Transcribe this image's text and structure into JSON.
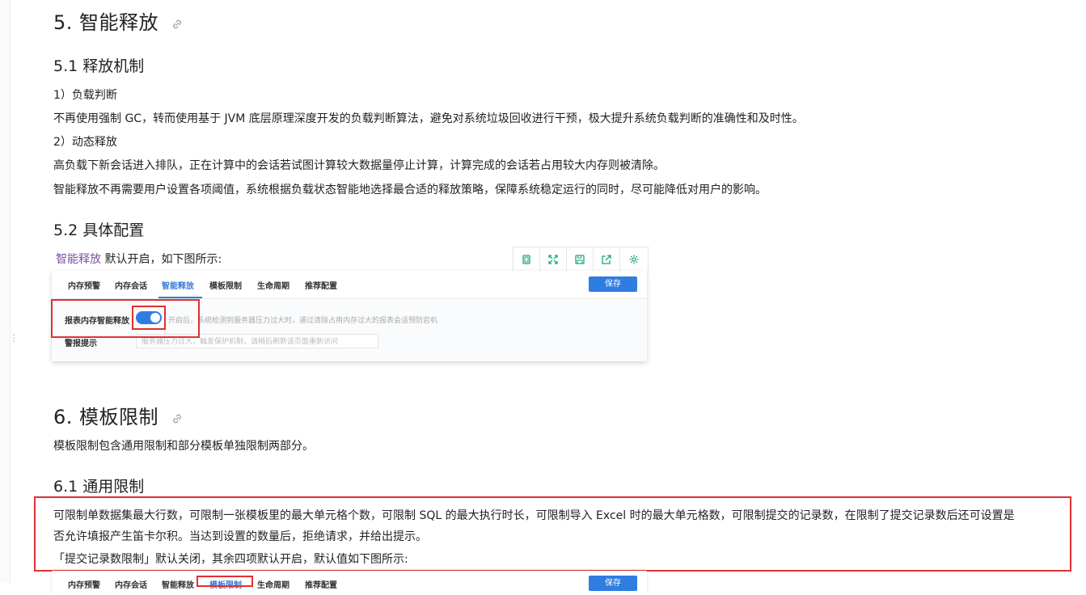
{
  "section5": {
    "title": "5. 智能释放",
    "s51": {
      "title": "5.1 释放机制",
      "item1_title": "1）负载判断",
      "item1_text": "不再使用强制 GC，转而使用基于 JVM 底层原理深度开发的负载判断算法，避免对系统垃圾回收进行干预，极大提升系统负载判断的准确性和及时性。",
      "item2_title": "2）动态释放",
      "item2_text": "高负载下新会话进入排队，正在计算中的会话若试图计算较大数据量停止计算，计算完成的会话若占用较大内存则被清除。",
      "item2_text2": "智能释放不再需要用户设置各项阈值，系统根据负载状态智能地选择最合适的释放策略，保障系统稳定运行的同时，尽可能降低对用户的影响。"
    },
    "s52": {
      "title": "5.2 具体配置",
      "intro_tag": "智能释放",
      "intro_rest": " 默认开启，如下图所示:"
    }
  },
  "toolbar": {
    "icons": [
      "copy-icon",
      "expand-icon",
      "save-icon",
      "share-icon",
      "settings-icon"
    ]
  },
  "card": {
    "tabs": [
      "内存预警",
      "内存会话",
      "智能释放",
      "模板限制",
      "生命周期",
      "推荐配置"
    ],
    "active_tab": "智能释放",
    "save_label": "保存",
    "row1_label": "报表内存智能释放",
    "row1_hint": "开启后，系统检测到服务器压力过大时，通过清除占用内存过大的报表会话预防宕机",
    "row2_label": "警报提示",
    "row2_input": "服务器压力过大，触发保护机制，请稍后刷新该页面重新访问"
  },
  "section6": {
    "title": "6. 模板限制",
    "intro": "模板限制包含通用限制和部分模板单独限制两部分。",
    "s61": {
      "title": "6.1 通用限制",
      "p1_line1": "可限制单数据集最大行数，可限制一张模板里的最大单元格个数，可限制 SQL 的最大执行时长，可限制导入 Excel 时的最大单元格数，可限制提交的记录数，在限制了提交记录数后还可设置是",
      "p1_line2": "否允许填报产生笛卡尔积。当达到设置的数量后，拒绝请求，并给出提示。",
      "p2": "「提交记录数限制」默认关闭，其余四项默认开启，默认值如下图所示:"
    }
  },
  "card2": {
    "tabs": [
      "内存预警",
      "内存会话",
      "智能释放",
      "模板限制",
      "生命周期",
      "推荐配置"
    ],
    "active_tab": "模板限制",
    "save_label": "保存"
  },
  "colors": {
    "accent": "#2f7de1",
    "highlight_box": "#e03030",
    "tag_purple": "#7b4fa3"
  }
}
